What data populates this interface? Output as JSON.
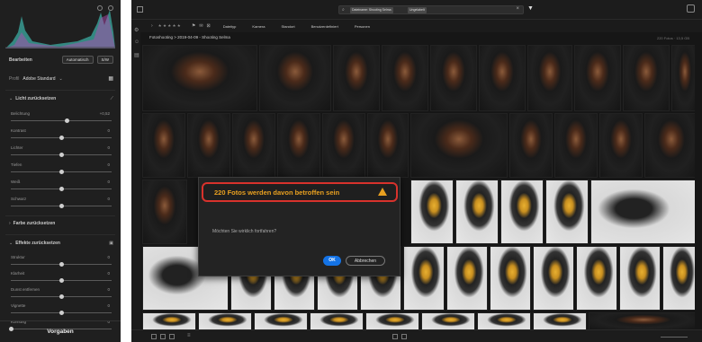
{
  "left_panel": {
    "edit_label": "Bearbeiten",
    "auto_button": "Automatisch",
    "sw_button": "S/W",
    "profile_label": "Profil",
    "profile_value": "Adobe Standard",
    "light_section": "Licht zurücksetzen",
    "color_section": "Farbe zurücksetzen",
    "effects_section": "Effekte zurücksetzen",
    "light_sliders": [
      {
        "label": "Belichtung",
        "value": "+0,52",
        "level": 0.55
      },
      {
        "label": "Kontrast",
        "value": "0",
        "level": 0.5
      },
      {
        "label": "Lichter",
        "value": "0",
        "level": 0.5
      },
      {
        "label": "Tiefen",
        "value": "0",
        "level": 0.5
      },
      {
        "label": "Weiß",
        "value": "0",
        "level": 0.5
      },
      {
        "label": "Schwarz",
        "value": "0",
        "level": 0.5
      }
    ],
    "effect_sliders": [
      {
        "label": "Struktur",
        "value": "0",
        "level": 0.5
      },
      {
        "label": "Klarheit",
        "value": "0",
        "level": 0.5
      },
      {
        "label": "Dunst entfernen",
        "value": "0",
        "level": 0.5
      },
      {
        "label": "Vignette",
        "value": "0",
        "level": 0.5
      },
      {
        "label": "Körnung",
        "value": "0",
        "level": 0.0
      }
    ],
    "presets_label": "Vorgaben"
  },
  "top_bar": {
    "search_chip_1": "Dateiname: Shooting Selma",
    "search_chip_2": "Ungelabelt",
    "stars": "★ ★ ★ ★ ★"
  },
  "filters": [
    "Dateityp",
    "Kamera",
    "Standort",
    "Benutzerdefiniert",
    "Personen"
  ],
  "breadcrumb": "Fotoshooting > 2019-04-09 - Shooting Selma",
  "count_label": "220 Fotos · 13,5 GB",
  "dialog": {
    "title": "220 Fotos werden davon betroffen sein",
    "message": "Möchten Sie wirklich fortfahren?",
    "ok": "OK",
    "cancel": "Abbrechen"
  },
  "colors": {
    "accent": "#1473e6",
    "warning": "#e8a020",
    "highlight_border": "#d8322c"
  }
}
